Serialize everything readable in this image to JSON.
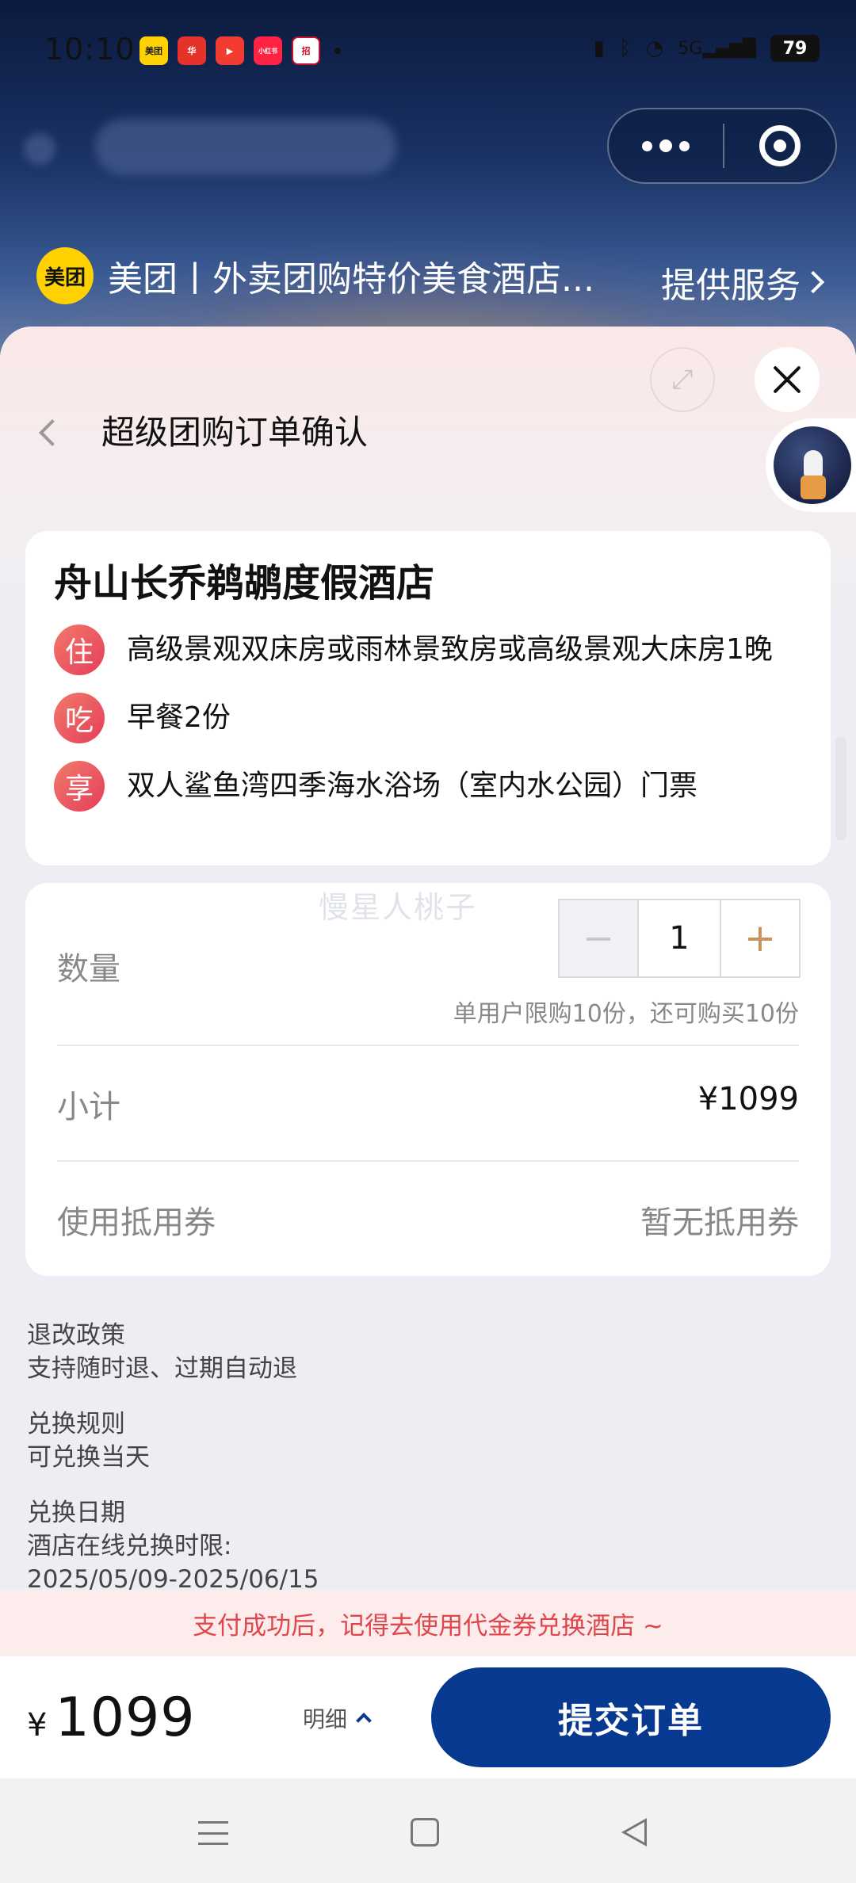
{
  "status_bar": {
    "time": "10:10",
    "notif_apps": [
      "美团",
      "华",
      "▶",
      "小红书",
      "招"
    ],
    "battery": "79",
    "network": "5G"
  },
  "capsule": {
    "more_icon": "more-dots-icon",
    "close_icon": "target-icon"
  },
  "service": {
    "logo": "美团",
    "title": "美团丨外卖团购特价美食酒店...",
    "link": "提供服务"
  },
  "page": {
    "title": "超级团购订单确认"
  },
  "hotel": {
    "name": "舟山长乔鹈鹕度假酒店",
    "features": [
      {
        "badge": "住",
        "text": "高级景观双床房或雨林景致房或高级景观大床房1晚"
      },
      {
        "badge": "吃",
        "text": "早餐2份"
      },
      {
        "badge": "享",
        "text": "双人鲨鱼湾四季海水浴场（室内水公园）门票"
      }
    ]
  },
  "order": {
    "watermark": "慢星人桃子",
    "quantity_label": "数量",
    "quantity_value": "1",
    "minus": "−",
    "plus": "+",
    "limit_note": "单用户限购10份，还可购买10份",
    "subtotal_label": "小计",
    "subtotal_value": "¥1099",
    "coupon_label": "使用抵用券",
    "coupon_value": "暂无抵用券"
  },
  "policy": {
    "refund_title": "退改政策",
    "refund_text": "支持随时退、过期自动退",
    "exchange_title": "兑换规则",
    "exchange_text": "可兑换当天",
    "date_title": "兑换日期",
    "date_line1": "酒店在线兑换时限:",
    "date_line2": "2025/05/09-2025/06/15"
  },
  "tip": "支付成功后，记得去使用代金券兑换酒店 ~",
  "bottom": {
    "currency": "¥",
    "amount": "1099",
    "detail": "明细",
    "submit": "提交订单"
  },
  "colors": {
    "brand_blue": "#06398f",
    "badge_red": "#e63e5a",
    "tip_red": "#e0454b",
    "meituan_yellow": "#ffd100"
  }
}
